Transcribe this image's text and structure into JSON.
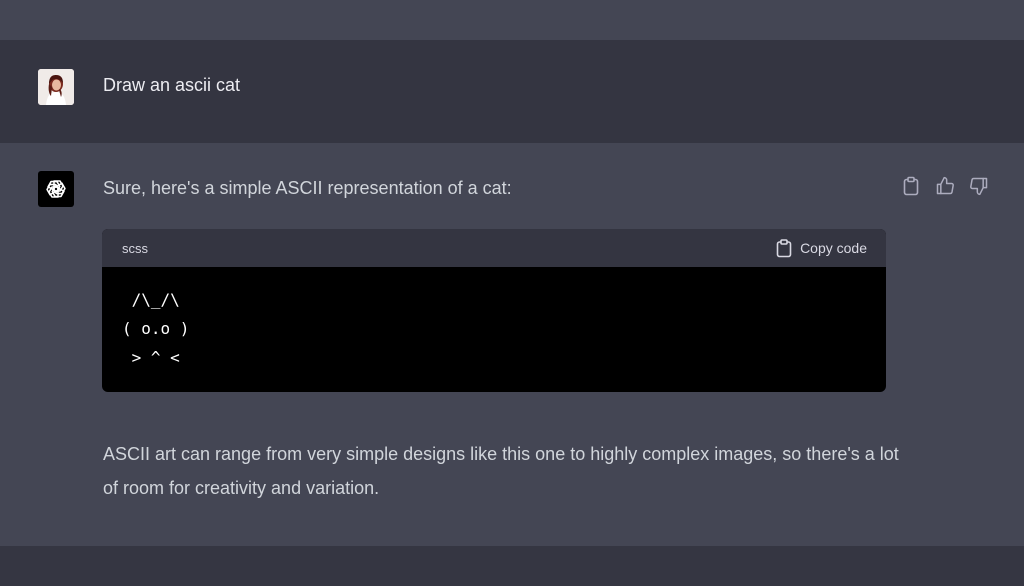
{
  "conversation": {
    "user_message": "Draw an ascii cat",
    "assistant": {
      "intro": "Sure, here's a simple ASCII representation of a cat:",
      "code_block": {
        "language": "scss",
        "copy_label": "Copy code",
        "code": " /\\_/\\\n( o.o )\n > ^ <"
      },
      "outro": "ASCII art can range from very simple designs like this one to highly complex images, so there's a lot of room for creativity and variation."
    }
  },
  "icons": {
    "user_avatar": "user-avatar",
    "assistant_logo": "openai-logo-icon",
    "copy": "clipboard-icon",
    "thumbs_up": "thumbs-up-icon",
    "thumbs_down": "thumbs-down-icon"
  },
  "colors": {
    "user_row_bg": "#343541",
    "assistant_row_bg": "#444654",
    "code_bg": "#000000",
    "code_header_bg": "#343541",
    "text_primary": "#ececf1",
    "text_secondary": "#d1d5db"
  }
}
